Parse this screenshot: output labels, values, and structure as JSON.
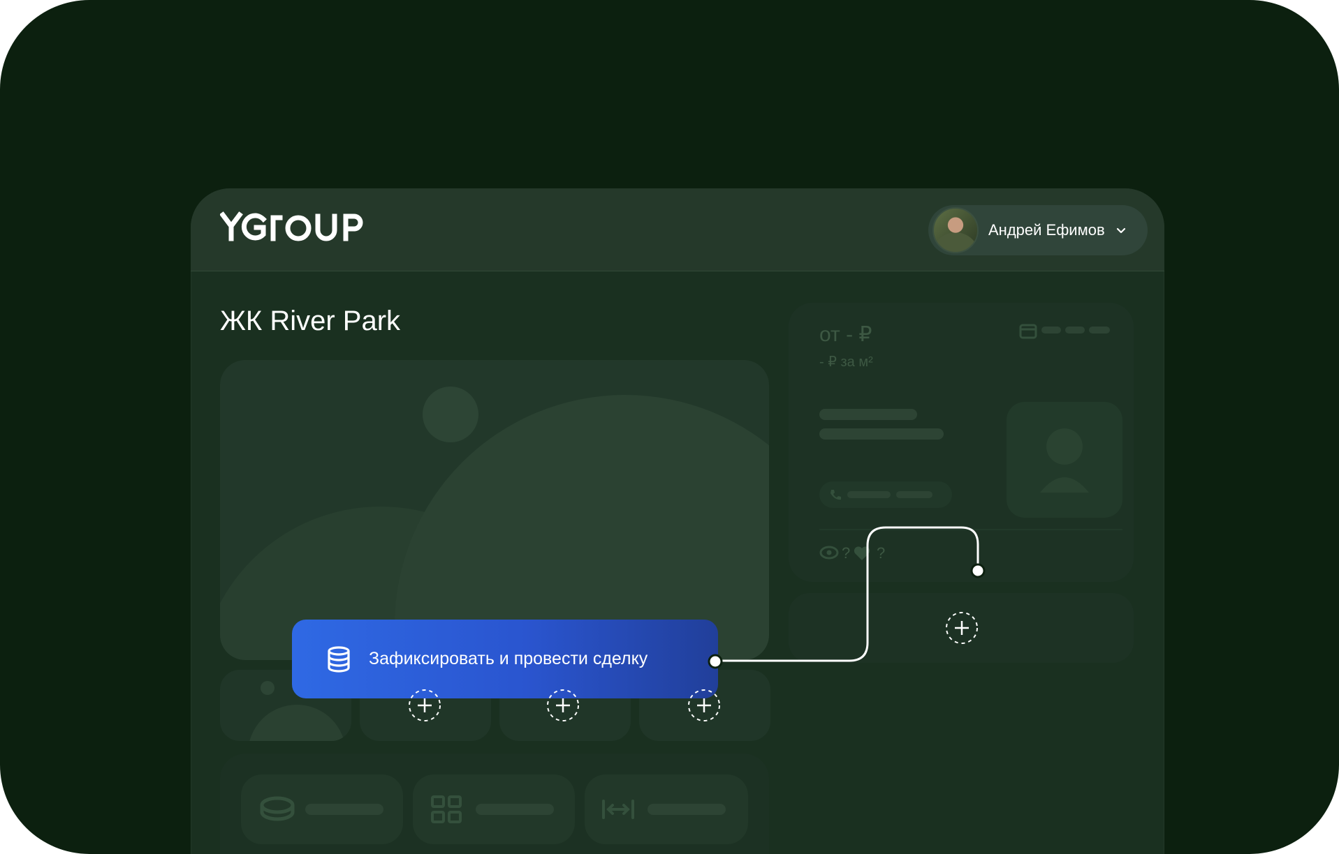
{
  "app": {
    "logo_text": "YGIOUP"
  },
  "header": {
    "user_name": "Андрей Ефимов"
  },
  "page": {
    "title": "ЖК River Park"
  },
  "listing_card": {
    "price": "от - ₽",
    "price_per_m2": "- ₽ за м²",
    "views_count": "?",
    "likes_count": "?"
  },
  "action": {
    "label": "Зафиксировать и провести сделку"
  },
  "colors": {
    "frame_bg": "#0c200f",
    "window_bg": "#1a3020",
    "header_bg": "#25392a",
    "action_gradient_start": "#2f69e4",
    "action_gradient_end": "#213f9a",
    "text_primary": "#ffffff",
    "text_muted": "#3d5843"
  },
  "icons": {
    "user_chip_chevron": "chevron-down-icon",
    "action": "database-icon",
    "add": "plus-icon",
    "calendar": "calendar-icon",
    "phone": "phone-icon",
    "eye": "eye-icon",
    "heart": "heart-icon",
    "coins": "coins-icon",
    "grid": "grid-icon",
    "width": "arrows-width-icon"
  }
}
